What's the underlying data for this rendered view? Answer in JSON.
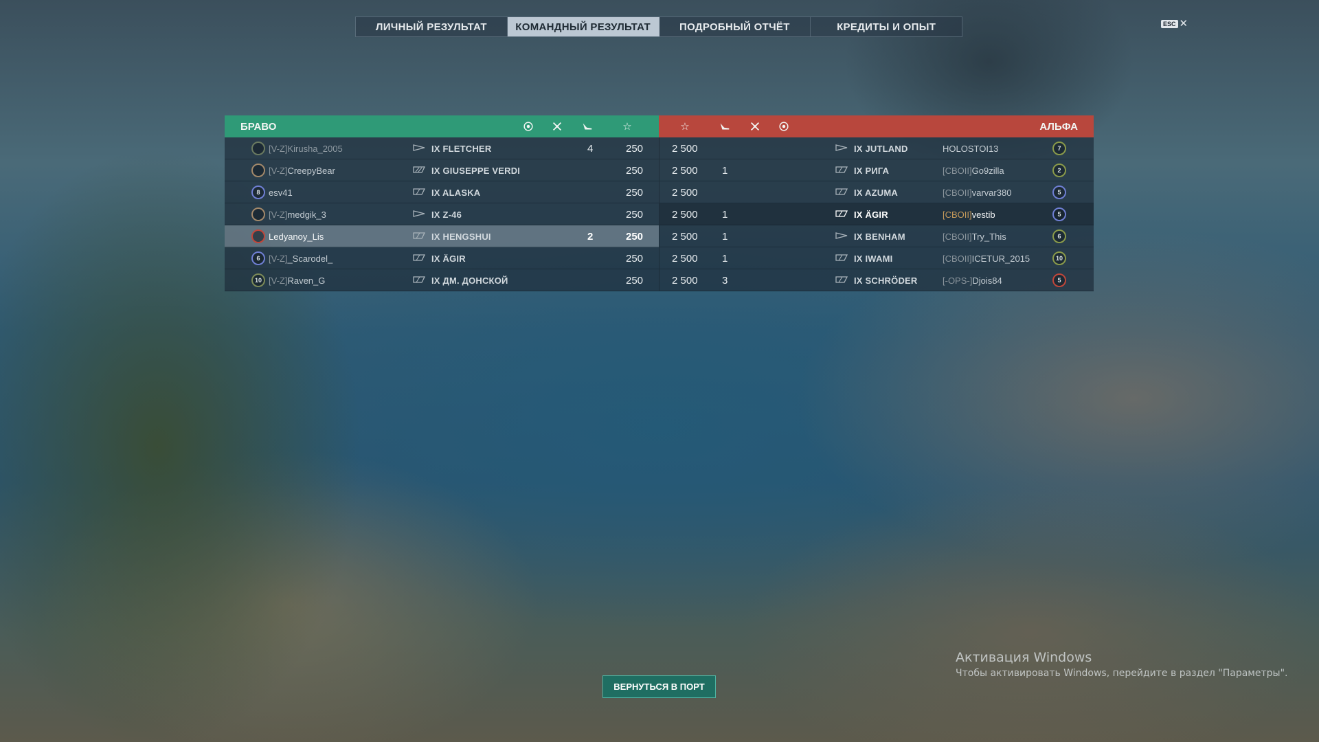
{
  "tabs": [
    {
      "label": "ЛИЧНЫЙ РЕЗУЛЬТАТ",
      "active": false
    },
    {
      "label": "КОМАНДНЫЙ РЕЗУЛЬТАТ",
      "active": true
    },
    {
      "label": "ПОДРОБНЫЙ ОТЧЁТ",
      "active": false
    },
    {
      "label": "КРЕДИТЫ И ОПЫТ",
      "active": false
    }
  ],
  "close": {
    "key_label": "ESC",
    "icon": "close-icon"
  },
  "header": {
    "left_team": "БРАВО",
    "right_team": "АЛЬФА",
    "left_color": "#2f9a77",
    "right_color": "#b8473d",
    "column_icons": [
      "ribbon-icon",
      "planes-icon",
      "ships-destroyed-icon",
      "star-icon"
    ]
  },
  "left_team": [
    {
      "badge": "",
      "badge_color": "#6a7a60",
      "clan": "[V-Z]",
      "name": "Kirusha_2005",
      "ship_tier": "IX",
      "ship": "FLETCHER",
      "ship_type": "destroyer",
      "kills": "4",
      "xp": "250"
    },
    {
      "badge": "",
      "badge_color": "#a2886a",
      "clan": "[V-Z]",
      "name": "CreepyBear",
      "ship_tier": "IX",
      "ship": "GIUSEPPE VERDI",
      "ship_type": "carrier",
      "kills": "",
      "xp": "250"
    },
    {
      "badge": "8",
      "badge_color": "#6f7fd3",
      "clan": "",
      "name": "esv41",
      "ship_tier": "IX",
      "ship": "ALASKA",
      "ship_type": "cruiser",
      "kills": "",
      "xp": "250"
    },
    {
      "badge": "",
      "badge_color": "#a2886a",
      "clan": "[V-Z]",
      "name": "medgik_3",
      "ship_tier": "IX",
      "ship": "Z-46",
      "ship_type": "destroyer",
      "kills": "",
      "xp": "250"
    },
    {
      "badge": "",
      "badge_color": "#c0463a",
      "clan": "",
      "name": "Ledyanoy_Lis",
      "ship_tier": "IX",
      "ship": "HENGSHUI",
      "ship_type": "cruiser",
      "kills": "2",
      "xp": "250",
      "highlight": true
    },
    {
      "badge": "6",
      "badge_color": "#6f7fd3",
      "clan": "[V-Z]",
      "name": "_Scarodel_",
      "ship_tier": "IX",
      "ship": "ÄGIR",
      "ship_type": "cruiser",
      "kills": "",
      "xp": "250"
    },
    {
      "badge": "10",
      "badge_color": "#7c8a58",
      "clan": "[V-Z]",
      "name": "Raven_G",
      "ship_tier": "IX",
      "ship": "ДМ. ДОНСКОЙ",
      "ship_type": "cruiser",
      "kills": "",
      "xp": "250"
    }
  ],
  "right_team": [
    {
      "xp": "2 500",
      "kills": "",
      "ship_tier": "IX",
      "ship": "JUTLAND",
      "ship_type": "destroyer",
      "clan": "",
      "name": "HOLOSTOI13",
      "badge": "7",
      "badge_color": "#8a9a4a"
    },
    {
      "xp": "2 500",
      "kills": "1",
      "ship_tier": "IX",
      "ship": "РИГА",
      "ship_type": "cruiser",
      "clan": "[CBOII]",
      "name": "Go9zilla",
      "badge": "2",
      "badge_color": "#8a9a4a"
    },
    {
      "xp": "2 500",
      "kills": "",
      "ship_tier": "IX",
      "ship": "AZUMA",
      "ship_type": "cruiser",
      "clan": "[CBOII]",
      "name": "varvar380",
      "badge": "5",
      "badge_color": "#6f7fd3"
    },
    {
      "xp": "2 500",
      "kills": "1",
      "ship_tier": "IX",
      "ship": "ÄGIR",
      "ship_type": "cruiser",
      "clan": "[CBOII]",
      "name": "vestib",
      "badge": "5",
      "badge_color": "#6f7fd3",
      "highlight": true
    },
    {
      "xp": "2 500",
      "kills": "1",
      "ship_tier": "IX",
      "ship": "BENHAM",
      "ship_type": "destroyer",
      "clan": "[CBOII]",
      "name": "Try_This",
      "badge": "6",
      "badge_color": "#8a9a4a"
    },
    {
      "xp": "2 500",
      "kills": "1",
      "ship_tier": "IX",
      "ship": "IWAMI",
      "ship_type": "cruiser",
      "clan": "[CBOII]",
      "name": "ICETUR_2015",
      "badge": "10",
      "badge_color": "#8a9a4a"
    },
    {
      "xp": "2 500",
      "kills": "3",
      "ship_tier": "IX",
      "ship": "SCHRÖDER",
      "ship_type": "cruiser",
      "clan": "[-OPS-]",
      "name": "Djois84",
      "badge": "5",
      "badge_color": "#c0463a"
    }
  ],
  "return_button": "ВЕРНУТЬСЯ В ПОРТ",
  "activation": {
    "title": "Активация Windows",
    "text": "Чтобы активировать Windows, перейдите в раздел \"Параметры\"."
  }
}
